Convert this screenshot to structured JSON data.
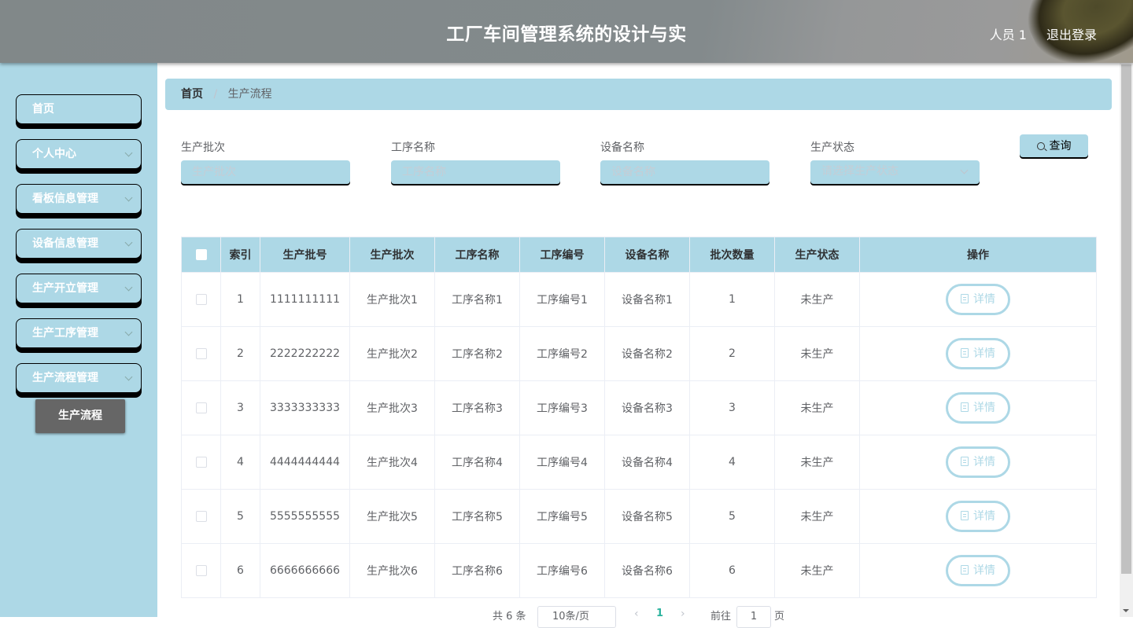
{
  "header": {
    "title": "工厂车间管理系统的设计与实",
    "user": "人员 1",
    "logout": "退出登录"
  },
  "sidebar": {
    "items": [
      {
        "label": "首页",
        "has_arrow": false
      },
      {
        "label": "个人中心",
        "has_arrow": true
      },
      {
        "label": "看板信息管理",
        "has_arrow": true
      },
      {
        "label": "设备信息管理",
        "has_arrow": true
      },
      {
        "label": "生产开立管理",
        "has_arrow": true
      },
      {
        "label": "生产工序管理",
        "has_arrow": true
      },
      {
        "label": "生产流程管理",
        "has_arrow": true
      }
    ],
    "submenu": {
      "label": "生产流程",
      "active": true
    }
  },
  "breadcrumb": {
    "home": "首页",
    "separator": "/",
    "current": "生产流程"
  },
  "search": {
    "fields": [
      {
        "label": "生产批次",
        "placeholder": "生产批次",
        "value": ""
      },
      {
        "label": "工序名称",
        "placeholder": "工序名称",
        "value": ""
      },
      {
        "label": "设备名称",
        "placeholder": "设备名称",
        "value": ""
      },
      {
        "label": "生产状态",
        "placeholder": "请选择生产状态",
        "value": ""
      }
    ],
    "button": "查询"
  },
  "table": {
    "columns": [
      "",
      "索引",
      "生产批号",
      "生产批次",
      "工序名称",
      "工序编号",
      "设备名称",
      "批次数量",
      "生产状态",
      "操作"
    ],
    "rows": [
      {
        "index": "1",
        "batch_no": "1111111111",
        "batch": "生产批次1",
        "process_name": "工序名称1",
        "process_code": "工序编号1",
        "device": "设备名称1",
        "qty": "1",
        "status": "未生产",
        "action": "详情"
      },
      {
        "index": "2",
        "batch_no": "2222222222",
        "batch": "生产批次2",
        "process_name": "工序名称2",
        "process_code": "工序编号2",
        "device": "设备名称2",
        "qty": "2",
        "status": "未生产",
        "action": "详情"
      },
      {
        "index": "3",
        "batch_no": "3333333333",
        "batch": "生产批次3",
        "process_name": "工序名称3",
        "process_code": "工序编号3",
        "device": "设备名称3",
        "qty": "3",
        "status": "未生产",
        "action": "详情"
      },
      {
        "index": "4",
        "batch_no": "4444444444",
        "batch": "生产批次4",
        "process_name": "工序名称4",
        "process_code": "工序编号4",
        "device": "设备名称4",
        "qty": "4",
        "status": "未生产",
        "action": "详情"
      },
      {
        "index": "5",
        "batch_no": "5555555555",
        "batch": "生产批次5",
        "process_name": "工序名称5",
        "process_code": "工序编号5",
        "device": "设备名称5",
        "qty": "5",
        "status": "未生产",
        "action": "详情"
      },
      {
        "index": "6",
        "batch_no": "6666666666",
        "batch": "生产批次6",
        "process_name": "工序名称6",
        "process_code": "工序编号6",
        "device": "设备名称6",
        "qty": "6",
        "status": "未生产",
        "action": "详情"
      }
    ]
  },
  "pagination": {
    "total": "共 6 条",
    "page_size": "10条/页",
    "prev": "‹",
    "current_page": "1",
    "next": "›",
    "goto_label": "前往",
    "goto_value": "1",
    "goto_suffix": "页"
  },
  "colors": {
    "accent": "#add8e6",
    "header_bg": "#828a8c",
    "submenu_active": "#666666",
    "pager_active": "#2bb39e"
  }
}
